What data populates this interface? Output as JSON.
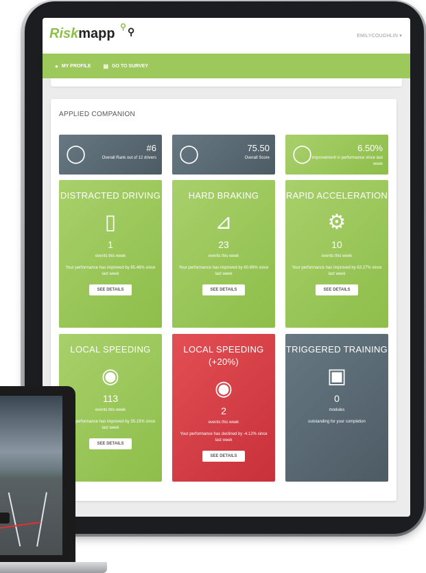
{
  "app": {
    "logo_part1": "Risk",
    "logo_part2": "mapp",
    "user_menu": "EMILYCOUGHLIN ▾"
  },
  "nav": [
    {
      "label": "MY PROFILE",
      "icon": "person-icon"
    },
    {
      "label": "GO TO SURVEY",
      "icon": "list-icon"
    }
  ],
  "panel_title": "APPLIED COMPANION",
  "stats": [
    {
      "value": "#6",
      "sub": "Overall Rank out of 12 drivers",
      "color": "grey"
    },
    {
      "value": "75.50",
      "sub": "Overall Score",
      "color": "grey"
    },
    {
      "value": "6.50%",
      "sub": "improvement in performance since last week",
      "color": "green"
    }
  ],
  "tiles": [
    {
      "title": "DISTRACTED DRIVING",
      "icon": "phone-icon",
      "count": "1",
      "label": "events this week",
      "perf": "Your performance has improved by 85.48% since last week",
      "button": "SEE DETAILS",
      "color": "green"
    },
    {
      "title": "HARD BRAKING",
      "icon": "brake-pedal-icon",
      "count": "23",
      "label": "events this week",
      "perf": "Your performance has improved by 60.69% since last week",
      "button": "SEE DETAILS",
      "color": "green"
    },
    {
      "title": "RAPID ACCELERATION",
      "icon": "wheel-icon",
      "count": "10",
      "label": "events this week",
      "perf": "Your performance has improved by 63.27% since last week",
      "button": "SEE DETAILS",
      "color": "green"
    },
    {
      "title": "LOCAL SPEEDING",
      "icon": "speeding-car-icon",
      "count": "113",
      "label": "events this week",
      "perf": "Your performance has improved by 35.15% since last week",
      "button": "SEE DETAILS",
      "color": "green"
    },
    {
      "title": "LOCAL SPEEDING (+20%)",
      "icon": "speeding-car-icon",
      "count": "2",
      "label": "events this week",
      "perf": "Your performance has declined by -4.12% since last week",
      "button": "SEE DETAILS",
      "color": "red"
    },
    {
      "title": "TRIGGERED TRAINING",
      "icon": "calendar-icon",
      "count": "0",
      "label": "modules",
      "perf": "outstanding for your completion",
      "button": "",
      "color": "grey"
    }
  ]
}
